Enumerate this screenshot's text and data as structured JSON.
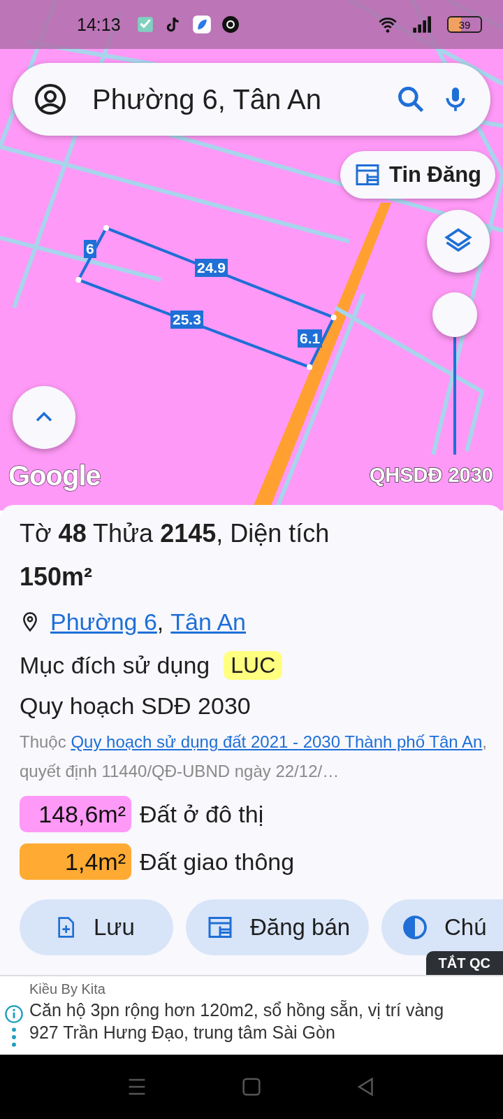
{
  "status_bar": {
    "time": "14:13",
    "battery": "39"
  },
  "search": {
    "value": "Phường 6, Tân An"
  },
  "map": {
    "post_button": "Tin Đăng",
    "edge_labels": [
      "6",
      "24.9",
      "25.3",
      "6.1"
    ],
    "attribution": "Google",
    "layer_name": "QHSDĐ 2030"
  },
  "sheet": {
    "title": "Tờ **48** Thửa **2145**, Diện tích **150m²**",
    "location": {
      "links": [
        "Phường 6",
        "Tân An"
      ],
      "separator": ","
    },
    "purpose": {
      "label": "Mục đích sử dụng",
      "code": "LUC"
    },
    "plan_title": "Quy hoạch SDĐ 2030",
    "plan_source": {
      "prefix": "Thuộc",
      "link": "Quy hoạch sử dụng đất 2021 - 2030 Thành phố Tân An",
      "suffix": ", quyết định 11440/QĐ-UBND ngày 22/12/…"
    },
    "legend": [
      {
        "area": "148,6m²",
        "label": "Đất ở đô thị",
        "color": "#ff99f7"
      },
      {
        "area": "1,4m²",
        "label": "Đất giao thông",
        "color": "#ffab33"
      }
    ],
    "actions": [
      {
        "kind": "save",
        "label": "Lưu"
      },
      {
        "kind": "post",
        "label": "Đăng bán"
      },
      {
        "kind": "legend",
        "label": "Chú"
      }
    ]
  },
  "ad": {
    "close_label": "TẮT QC",
    "advertiser": "Kiều By Kita",
    "text": "Căn hộ 3pn rộng hơn 120m2, sổ hồng sẵn, vị trí vàng 927 Trần Hưng Đạo, trung tâm Sài Gòn"
  }
}
